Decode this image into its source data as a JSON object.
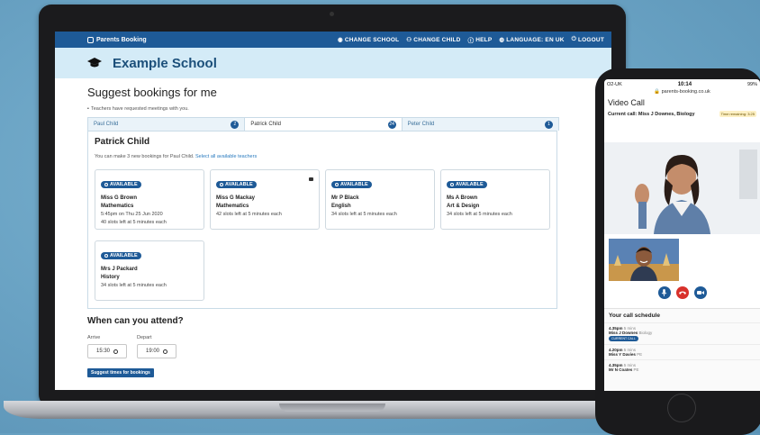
{
  "app": {
    "brand": "Parents Booking",
    "nav": [
      "CHANGE SCHOOL",
      "CHANGE CHILD",
      "HELP",
      "LANGUAGE: EN UK",
      "LOGOUT"
    ],
    "school": "Example School"
  },
  "main": {
    "title": "Suggest bookings for me",
    "note": "Teachers have requested meetings with you.",
    "tabs": [
      {
        "label": "Paul Child",
        "badge": "2"
      },
      {
        "label": "Patrick Child",
        "badge": "24"
      },
      {
        "label": "Peter Child",
        "badge": "1"
      }
    ],
    "child_name": "Patrick Child",
    "info_text": "You can make 3 new bookings for Paul Child.",
    "info_link": "Select all available teachers",
    "cards": [
      {
        "badge": "AVAILABLE",
        "name": "Miss G Brown",
        "subject": "Mathematics",
        "line1": "5:45pm on Thu 25 Jun 2020",
        "line2": "40 slots left at 5 minutes each"
      },
      {
        "badge": "AVAILABLE",
        "name": "Miss G Mackay",
        "subject": "Mathematics",
        "line1": "42 slots left at 5 minutes each",
        "line2": ""
      },
      {
        "badge": "AVAILABLE",
        "name": "Mr P Black",
        "subject": "English",
        "line1": "34 slots left at 5 minutes each",
        "line2": ""
      },
      {
        "badge": "AVAILABLE",
        "name": "Ms A Brown",
        "subject": "Art & Design",
        "line1": "34 slots left at 5 minutes each",
        "line2": ""
      },
      {
        "badge": "AVAILABLE",
        "name": "Mrs J Packard",
        "subject": "History",
        "line1": "34 slots left at 5 minutes each",
        "line2": ""
      }
    ],
    "attend_title": "When can you attend?",
    "arrive_label": "Arrive",
    "arrive_value": "15:30",
    "depart_label": "Depart",
    "depart_value": "19:00",
    "suggest_button": "Suggest times for bookings"
  },
  "phone": {
    "carrier": "O2-UK",
    "time": "10:14",
    "battery": "99%",
    "url": "parents-booking.co.uk",
    "title": "Video Call",
    "current_call": "Current call: Miss J Downes, Biology",
    "time_remaining": "Time remaining: 3:25",
    "schedule_title": "Your call schedule",
    "schedule": [
      {
        "time": "4.35pm",
        "duration": "5 mins",
        "name": "Miss J Downes",
        "subject": "Biology",
        "tag": "CURRENT CALL"
      },
      {
        "time": "4.20pm",
        "duration": "5 mins",
        "name": "Miss Y Davies",
        "subject": "PE",
        "tag": ""
      },
      {
        "time": "4.35pm",
        "duration": "5 mins",
        "name": "Mr N Coates",
        "subject": "PE",
        "tag": ""
      }
    ]
  }
}
